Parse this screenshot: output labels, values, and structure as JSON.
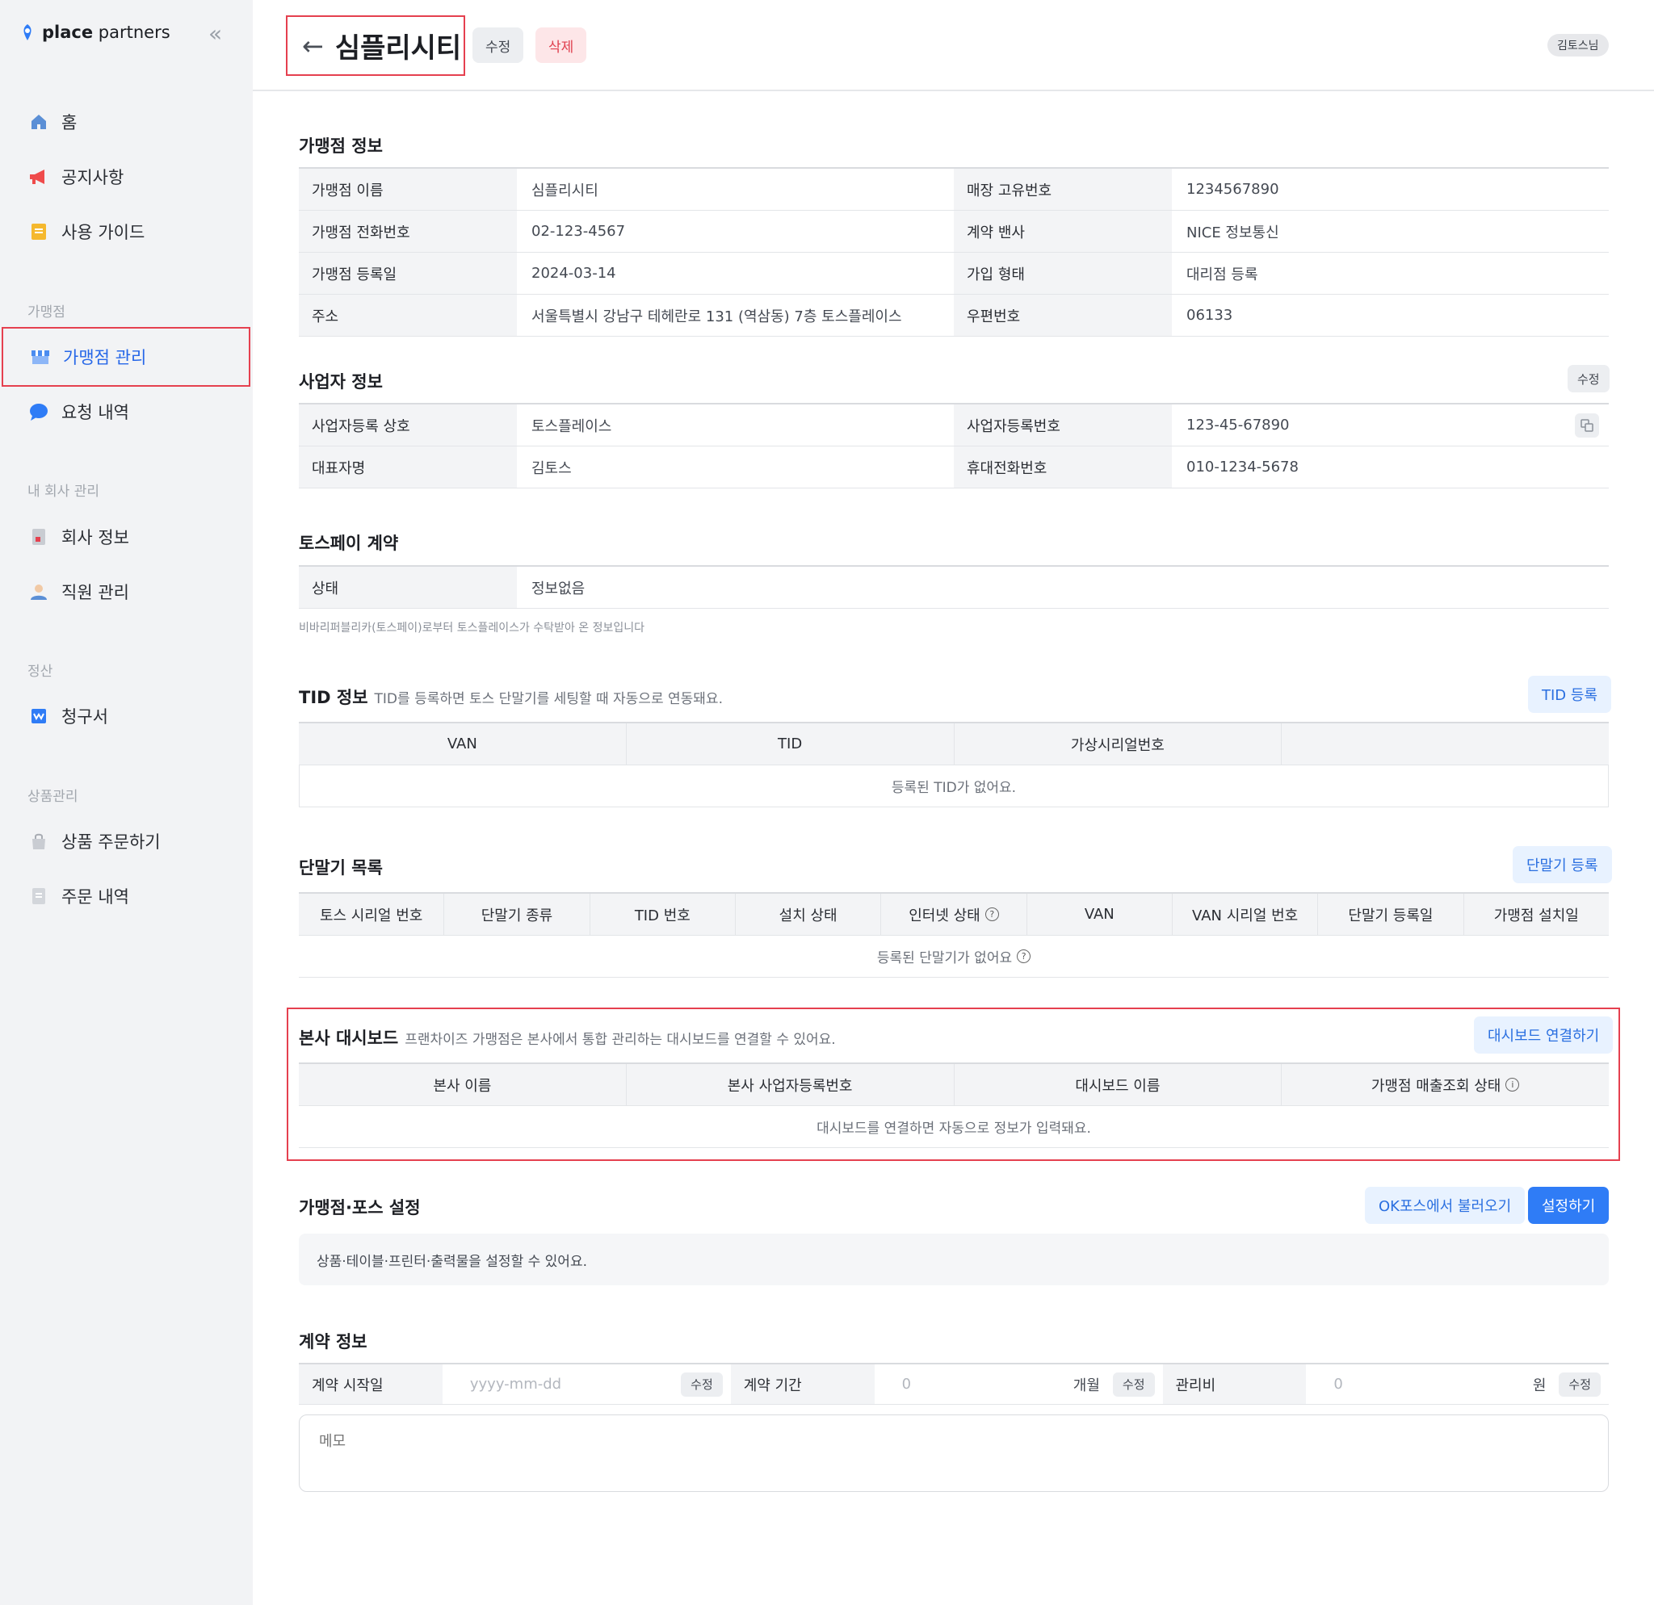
{
  "sidebar": {
    "brand_a": "place",
    "brand_b": " partners",
    "collapse": "«",
    "home": "홈",
    "notice": "공지사항",
    "guide": "사용 가이드",
    "section_store": "가맹점",
    "store_manage": "가맹점 관리",
    "requests": "요청 내역",
    "section_company": "내 회사 관리",
    "company_info": "회사 정보",
    "staff": "직원 관리",
    "section_settle": "정산",
    "invoice": "청구서",
    "section_product": "상품관리",
    "order_product": "상품 주문하기",
    "order_history": "주문 내역"
  },
  "header": {
    "back": "←",
    "title": "심플리시티",
    "edit": "수정",
    "delete": "삭제",
    "user": "김토스님"
  },
  "store_info": {
    "title": "가맹점 정보",
    "rows": [
      {
        "k1": "가맹점 이름",
        "v1": "심플리시티",
        "k2": "매장 고유번호",
        "v2": "1234567890"
      },
      {
        "k1": "가맹점 전화번호",
        "v1": "02-123-4567",
        "k2": "계약 밴사",
        "v2": "NICE 정보통신"
      },
      {
        "k1": "가맹점 등록일",
        "v1": "2024-03-14",
        "k2": "가입 형태",
        "v2": "대리점 등록"
      },
      {
        "k1": "주소",
        "v1": "서울특별시 강남구 테헤란로 131 (역삼동) 7층 토스플레이스",
        "k2": "우편번호",
        "v2": "06133"
      }
    ]
  },
  "biz_info": {
    "title": "사업자 정보",
    "edit": "수정",
    "rows": [
      {
        "k1": "사업자등록 상호",
        "v1": "토스플레이스",
        "k2": "사업자등록번호",
        "v2": "123-45-67890"
      },
      {
        "k1": "대표자명",
        "v1": "김토스",
        "k2": "휴대전화번호",
        "v2": "010-1234-5678"
      }
    ]
  },
  "tosspay": {
    "title": "토스페이 계약",
    "status_k": "상태",
    "status_v": "정보없음",
    "note": "비바리퍼블리카(토스페이)로부터 토스플레이스가 수탁받아 온 정보입니다"
  },
  "tid": {
    "title": "TID 정보",
    "desc": "TID를 등록하면 토스 단말기를 세팅할 때 자동으로 연동돼요.",
    "button": "TID 등록",
    "columns": [
      "VAN",
      "TID",
      "가상시리얼번호",
      ""
    ],
    "empty": "등록된 TID가 없어요."
  },
  "terminal": {
    "title": "단말기 목록",
    "button": "단말기 등록",
    "columns": [
      "토스 시리얼 번호",
      "단말기 종류",
      "TID 번호",
      "설치 상태",
      "인터넷 상태",
      "VAN",
      "VAN 시리얼 번호",
      "단말기 등록일",
      "가맹점 설치일"
    ],
    "empty": "등록된 단말기가 없어요"
  },
  "hq": {
    "title": "본사 대시보드",
    "desc": "프랜차이즈 가맹점은 본사에서 통합 관리하는 대시보드를 연결할 수 있어요.",
    "button": "대시보드 연결하기",
    "columns": [
      "본사 이름",
      "본사 사업자등록번호",
      "대시보드 이름",
      "가맹점 매출조회 상태"
    ],
    "empty": "대시보드를 연결하면 자동으로 정보가 입력돼요."
  },
  "pos": {
    "title": "가맹점·포스 설정",
    "import_btn": "OK포스에서 불러오기",
    "setup_btn": "설정하기",
    "desc": "상품·테이블·프린터·출력물을 설정할 수 있어요."
  },
  "contract": {
    "title": "계약 정보",
    "start_k": "계약 시작일",
    "start_ph": "yyyy-mm-dd",
    "period_k": "계약 기간",
    "period_v": "0",
    "period_unit": "개월",
    "fee_k": "관리비",
    "fee_v": "0",
    "fee_unit": "원",
    "edit": "수정",
    "memo_ph": "메모"
  },
  "colors": {
    "accent": "#2f7cf6",
    "highlight": "#e5404f",
    "danger": "#e0404f"
  }
}
